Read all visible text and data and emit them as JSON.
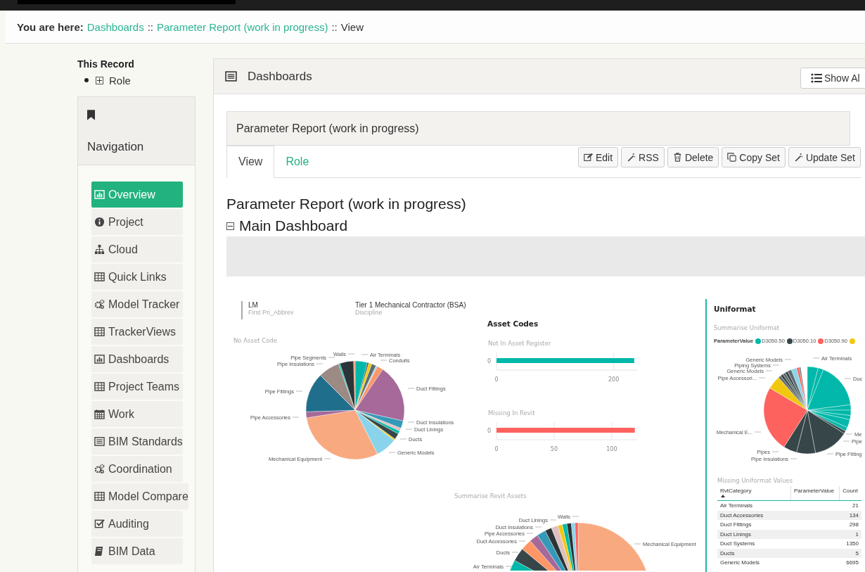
{
  "breadcrumb": {
    "prefix": "You are here:",
    "parts": [
      {
        "text": "Dashboards",
        "kind": "link"
      },
      {
        "text": "::",
        "kind": "separator"
      },
      {
        "text": "Parameter Report (work in progress)",
        "kind": "link"
      },
      {
        "text": "::",
        "kind": "separator"
      },
      {
        "text": "View",
        "kind": "current"
      }
    ]
  },
  "record": {
    "title": "This Record",
    "items": [
      {
        "label": "Role",
        "expanded": false
      }
    ]
  },
  "navigation": {
    "title": "Navigation",
    "items": [
      {
        "label": "Overview",
        "selected": true
      },
      {
        "label": "Project",
        "selected": false
      },
      {
        "label": "Cloud",
        "selected": false
      },
      {
        "label": "Quick Links",
        "selected": false
      },
      {
        "label": "Model Tracker",
        "selected": false
      },
      {
        "label": "TrackerViews",
        "selected": false
      },
      {
        "label": "Dashboards",
        "selected": false
      },
      {
        "label": "Project Teams",
        "selected": false
      },
      {
        "label": "Work",
        "selected": false
      },
      {
        "label": "BIM Standards",
        "selected": false
      },
      {
        "label": "Coordination",
        "selected": false
      },
      {
        "label": "Model Compare",
        "selected": false
      },
      {
        "label": "Auditing",
        "selected": false
      },
      {
        "label": "BIM Data",
        "selected": false
      }
    ]
  },
  "panel": {
    "title": "Dashboards",
    "show_all_button": "Show Al"
  },
  "report_panel": {
    "title": "Parameter Report (work in progress)",
    "tabs": [
      {
        "label": "View",
        "selected": true
      },
      {
        "label": "Role",
        "selected": false
      }
    ],
    "actions": [
      "Edit",
      "RSS",
      "Delete",
      "Copy Set",
      "Update Set"
    ]
  },
  "heading": "Parameter Report (work in progress)",
  "section": {
    "title": "Main Dashboard",
    "expanded": true
  },
  "report": {
    "first_card": {
      "value": "LM",
      "caption": "First Pri_Abbrev"
    },
    "discipline_card": {
      "value": "Tier 1 Mechanical Contractor (BSA)",
      "caption": "Discipline"
    },
    "no_asset_pie": {
      "title": "No Asset Code",
      "labels": [
        "Walls",
        "Air Terminals",
        "Conduits",
        "Pipe Segments",
        "Pipe Insulations",
        "Duct Fittings",
        "Pipe Fittings",
        "Pipe Accessories",
        "Duct Insulations",
        "Duct Linings",
        "Ducts",
        "Generic Models",
        "Mechanical Equipment"
      ]
    },
    "asset_codes": {
      "title": "Asset Codes",
      "charts": [
        {
          "title": "Not In Asset Register",
          "chart_data": {
            "type": "bar",
            "orientation": "horizontal",
            "categories": [
              "0"
            ],
            "series": [
              {
                "color": "#01b8aa",
                "values": [
                  235
                ]
              }
            ],
            "xlim": [
              0,
              240
            ],
            "xticks": [
              0,
              200
            ]
          }
        },
        {
          "title": "Missing In Revit",
          "chart_data": {
            "type": "bar",
            "orientation": "horizontal",
            "categories": [
              "0"
            ],
            "series": [
              {
                "color": "#fd625e",
                "values": [
                  120
                ]
              }
            ],
            "xlim": [
              0,
              122
            ],
            "xticks": [
              0,
              50,
              100
            ]
          }
        }
      ]
    },
    "revit_pie": {
      "title": "Summarise Revit Assets",
      "labels": [
        "Walls",
        "Duct Linings",
        "Duct Insulations",
        "Pipe Accessories",
        "Duct Accessories",
        "Ducts",
        "Air Terminals",
        "Mechanical Equipment"
      ]
    },
    "uniformat": {
      "title": "Uniformat",
      "subtitle": "Summarise Uniformat",
      "legend": {
        "title": "ParameterValue",
        "items": [
          {
            "label": "D3050.50",
            "color": "#01b8aa"
          },
          {
            "label": "D3050.10",
            "color": "#374649"
          },
          {
            "label": "D3050.90",
            "color": "#fd625e"
          },
          {
            "color": "#f2c80f"
          }
        ]
      },
      "labels": [
        "Generic Models",
        "Piping Systems",
        "Generic Models",
        "Pipe Accessori...",
        "Air Terminals",
        "Duc",
        "Mechanical E...",
        "Me",
        "Pipe",
        "Pipes",
        "Pipe Insulations",
        "Pipe Fitting"
      ],
      "table": {
        "title": "Missing Uniformat Values",
        "columns": [
          {
            "label": "RvtCategory",
            "sorted": true
          },
          {
            "label": "ParameterValue",
            "sorted": false
          },
          {
            "label": "Count",
            "sorted": false
          }
        ],
        "rows": [
          {
            "category": "Air Terminals",
            "count": "21"
          },
          {
            "category": "Duct Accessories",
            "count": "134"
          },
          {
            "category": "Duct Fittings",
            "count": "298"
          },
          {
            "category": "Duct Linings",
            "count": "1"
          },
          {
            "category": "Duct Systems",
            "count": "1350"
          },
          {
            "category": "Ducts",
            "count": "5"
          },
          {
            "category": "Generic Models",
            "count": "6695"
          }
        ]
      }
    }
  }
}
